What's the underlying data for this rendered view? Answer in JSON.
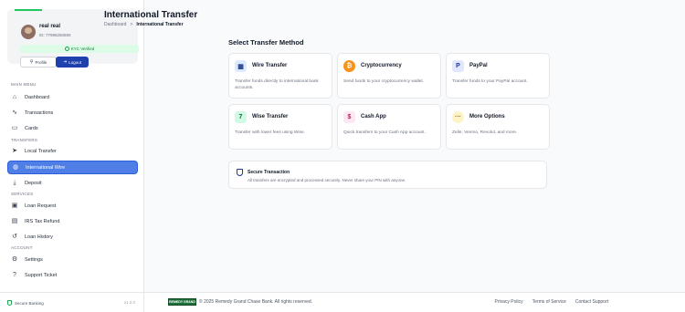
{
  "user": {
    "name": "real real",
    "id": "ID: 77998250690",
    "kyc_label": "KYC Verified",
    "profile_label": "Profile",
    "logout_label": "Logout"
  },
  "sidebar": {
    "sections": {
      "main_menu": "MAIN MENU",
      "transfers": "TRANSFERS",
      "services": "SERVICES",
      "account": "ACCOUNT"
    },
    "items": [
      {
        "label": "Dashboard",
        "icon": "home-icon"
      },
      {
        "label": "Transactions",
        "icon": "activity-icon"
      },
      {
        "label": "Cards",
        "icon": "credit-card-icon"
      },
      {
        "label": "Local Transfer",
        "icon": "send-icon"
      },
      {
        "label": "International Wire",
        "icon": "globe-icon",
        "active": true
      },
      {
        "label": "Deposit",
        "icon": "download-icon"
      },
      {
        "label": "Loan Request",
        "icon": "loan-icon"
      },
      {
        "label": "IRS Tax Refund",
        "icon": "receipt-icon"
      },
      {
        "label": "Loan History",
        "icon": "history-icon"
      },
      {
        "label": "Settings",
        "icon": "gear-icon"
      },
      {
        "label": "Support Ticket",
        "icon": "help-icon"
      }
    ],
    "footer_secure": "Secure Banking",
    "footer_version": "v1.2.0"
  },
  "header": {
    "title": "International Transfer",
    "breadcrumb_home": "Dashboard",
    "breadcrumb_sep": ">",
    "breadcrumb_current": "International Transfer"
  },
  "main": {
    "section_title": "Select Transfer Method",
    "methods": [
      {
        "title": "Wire Transfer",
        "desc": "Transfer funds directly to international bank accounts.",
        "icon": "bank-icon",
        "color": "#dbeafe"
      },
      {
        "title": "Cryptocurrency",
        "desc": "Send funds to your cryptocurrency wallet.",
        "icon": "bitcoin-icon",
        "color": "#f7931a"
      },
      {
        "title": "PayPal",
        "desc": "Transfer funds to your PayPal account.",
        "icon": "paypal-icon",
        "color": "#e0e7ff"
      },
      {
        "title": "Wise Transfer",
        "desc": "Transfer with lower fees using Wise.",
        "icon": "wise-icon",
        "color": "#d1fae5"
      },
      {
        "title": "Cash App",
        "desc": "Quick transfers to your Cash App account.",
        "icon": "cashapp-icon",
        "color": "#fce7f3"
      },
      {
        "title": "More Options",
        "desc": "Zelle, Venmo, Revolut, and more.",
        "icon": "more-icon",
        "color": "#fef3c7"
      }
    ],
    "secure_title": "Secure Transaction",
    "secure_desc": "All transfers are encrypted and processed securely. Never share your PIN with anyone."
  },
  "footer": {
    "logo_text": "REMEDY GRAND",
    "copyright": "© 2025 Remedy Grand Chase Bank. All rights reserved.",
    "links": [
      "Privacy Policy",
      "Terms of Service",
      "Contact Support"
    ]
  }
}
